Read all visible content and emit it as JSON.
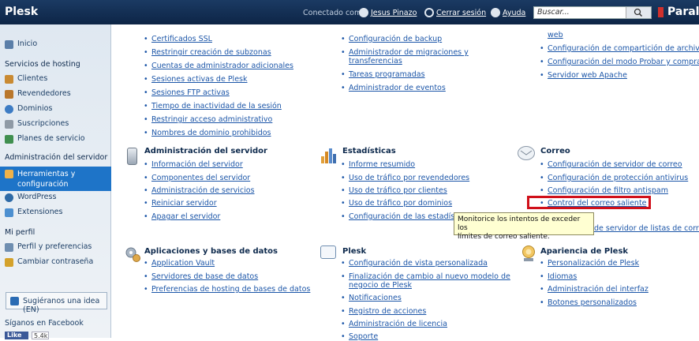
{
  "header": {
    "brand": "Plesk",
    "connected_as": "Conectado como",
    "user": "Jesus Pinazo",
    "logout": "Cerrar sesión",
    "help": "Ayuda",
    "search_placeholder": "Buscar...",
    "partner": "Paral"
  },
  "sidebar": {
    "items": [
      {
        "label": "Inicio",
        "type": "link"
      },
      {
        "label": "Servicios de hosting",
        "type": "head"
      },
      {
        "label": "Clientes",
        "type": "link"
      },
      {
        "label": "Revendedores",
        "type": "link"
      },
      {
        "label": "Dominios",
        "type": "link"
      },
      {
        "label": "Suscripciones",
        "type": "link"
      },
      {
        "label": "Planes de servicio",
        "type": "link"
      },
      {
        "label": "Administración del servidor",
        "type": "head"
      },
      {
        "label": "Herramientas y configuración",
        "type": "active"
      },
      {
        "label": "WordPress",
        "type": "link"
      },
      {
        "label": "Extensiones",
        "type": "link"
      },
      {
        "label": "Mi perfil",
        "type": "head"
      },
      {
        "label": "Perfil y preferencias",
        "type": "link"
      },
      {
        "label": "Cambiar contraseña",
        "type": "link"
      }
    ],
    "idea": "Sugiéranos una idea (EN)",
    "facebook": "Síganos en Facebook",
    "like": "Like",
    "like_count": "5.4k"
  },
  "col1_top": [
    "Certificados SSL",
    "Restringir creación de subzonas",
    "Cuentas de administrador adicionales",
    "Sesiones activas de Plesk",
    "Sesiones FTP activas",
    "Tiempo de inactividad de la sesión",
    "Restringir acceso administrativo",
    "Nombres de dominio prohibidos"
  ],
  "col2_top": [
    "Configuración de backup",
    "Administrador de migraciones y",
    "transferencias",
    "Tareas programadas",
    "Administrador de eventos"
  ],
  "col3_top": [
    "web",
    "Configuración de compartición de archivos",
    "Configuración del modo Probar y comprar",
    "Servidor web Apache"
  ],
  "sections": {
    "server_admin": {
      "title": "Administración del servidor",
      "links": [
        "Información del servidor",
        "Componentes del servidor",
        "Administración de servicios",
        "Reiniciar servidor",
        "Apagar el servidor"
      ]
    },
    "stats": {
      "title": "Estadísticas",
      "links": [
        "Informe resumido",
        "Uso de tráfico por revendedores",
        "Uso de tráfico por clientes",
        "Uso de tráfico por dominios",
        "Configuración de las estadísticas"
      ]
    },
    "mail": {
      "title": "Correo",
      "links": [
        "Configuración de servidor de correo",
        "Configuración de protección antivirus",
        "Configuración de filtro antispam",
        "Control del correo saliente",
        "de servidor de listas de correo"
      ]
    },
    "apps": {
      "title": "Aplicaciones y bases de datos",
      "links": [
        "Application Vault",
        "Servidores de base de datos",
        "Preferencias de hosting de bases de datos"
      ]
    },
    "plesk": {
      "title": "Plesk",
      "links": [
        "Configuración de vista personalizada",
        "Finalización de cambio al nuevo modelo de",
        "negocio de Plesk",
        "Notificaciones",
        "Registro de acciones",
        "Administración de licencia",
        "Soporte"
      ]
    },
    "appearance": {
      "title": "Apariencia de Plesk",
      "links": [
        "Personalización de Plesk",
        "Idiomas",
        "Administración del interfaz",
        "Botones personalizados"
      ]
    }
  },
  "tooltip": {
    "line1": "Monitorice los intentos de exceder los",
    "line2": "límites de correo saliente."
  },
  "colors": {
    "header": "#0d2546",
    "accent": "#1e74c8",
    "link": "#1c56a8",
    "highlight": "#d0101a",
    "tooltip_bg": "#ffffd2"
  }
}
